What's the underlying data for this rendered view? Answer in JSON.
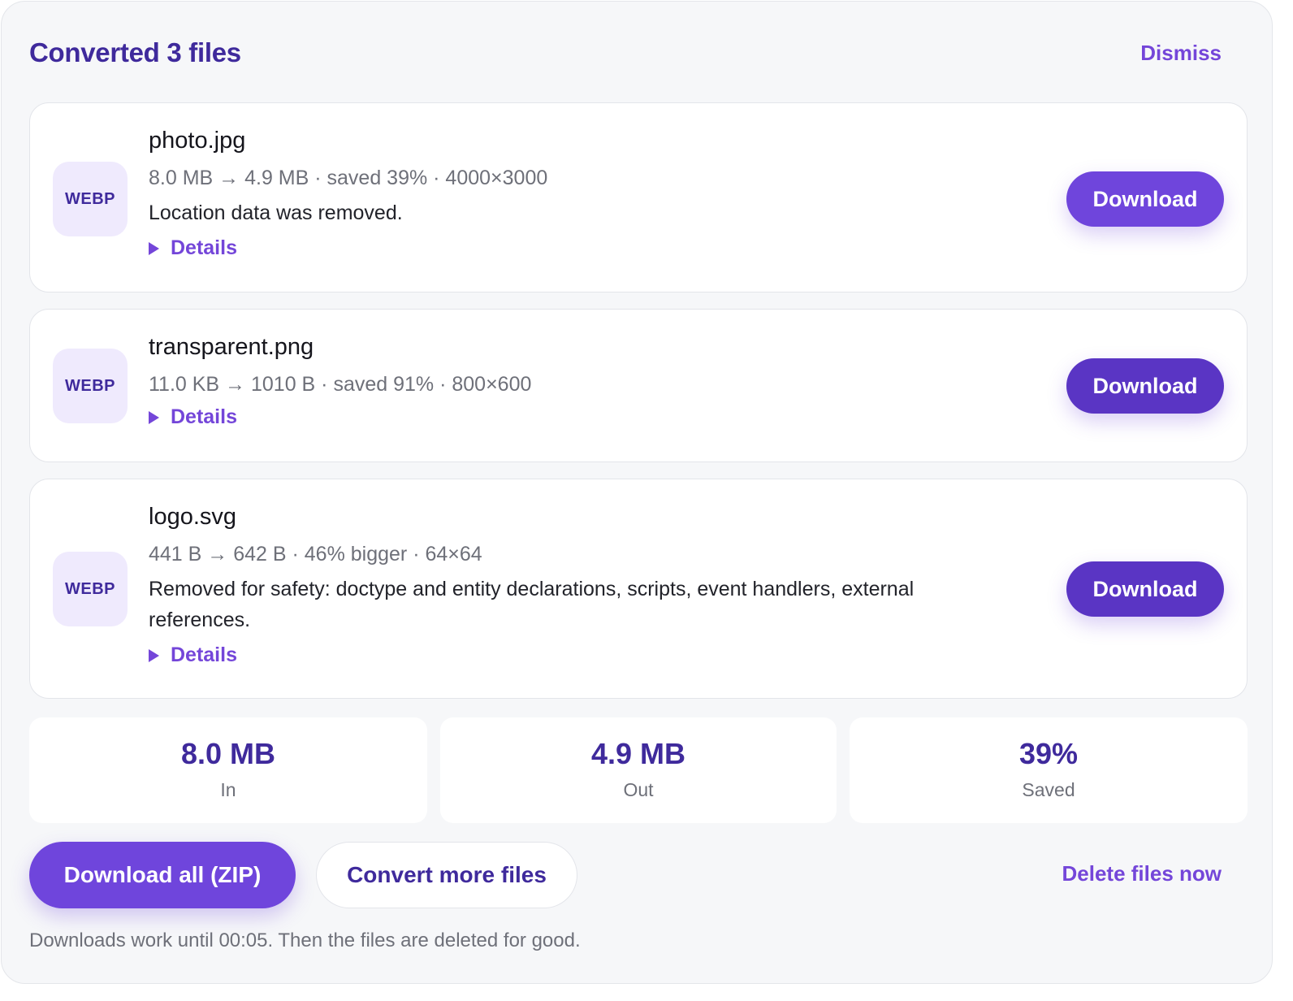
{
  "header": {
    "title": "Converted 3 files",
    "dismiss_label": "Dismiss"
  },
  "files": [
    {
      "badge": "WEBP",
      "name": "photo.jpg",
      "meta": "8.0 MB → 4.9 MB · saved 39% · 4000×3000",
      "note": "Location data was removed.",
      "details_label": "Details",
      "download_label": "Download"
    },
    {
      "badge": "WEBP",
      "name": "transparent.png",
      "meta": "11.0 KB → 1010 B · saved 91% · 800×600",
      "details_label": "Details",
      "download_label": "Download"
    },
    {
      "badge": "WEBP",
      "name": "logo.svg",
      "meta": "441 B → 642 B · 46% bigger · 64×64",
      "note": "Removed for safety: doctype and entity declarations, scripts, event handlers, external references.",
      "details_label": "Details",
      "download_label": "Download"
    }
  ],
  "stats": [
    {
      "value": "8.0 MB",
      "label": "In"
    },
    {
      "value": "4.9 MB",
      "label": "Out"
    },
    {
      "value": "39%",
      "label": "Saved"
    }
  ],
  "actions": {
    "download_all_label": "Download all (ZIP)",
    "convert_more_label": "Convert more files",
    "delete_label": "Delete files now"
  },
  "footnote": "Downloads work until 00:05. Then the files are deleted for good.",
  "colors": {
    "accent": "#6f45dc",
    "title": "#3f2a9c",
    "badge_bg": "#efeafd",
    "panel_bg": "#f6f7f9"
  }
}
